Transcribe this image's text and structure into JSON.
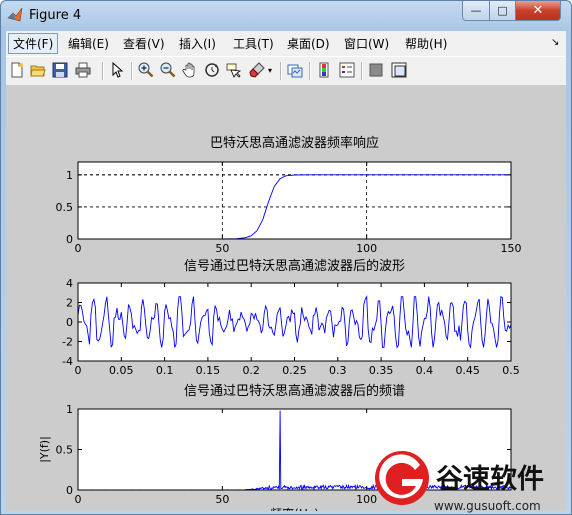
{
  "window": {
    "title": "Figure 4"
  },
  "menu": [
    "文件(F)",
    "编辑(E)",
    "查看(V)",
    "插入(I)",
    "工具(T)",
    "桌面(D)",
    "窗口(W)",
    "帮助(H)"
  ],
  "window_controls": {
    "minimize": "—",
    "maximize": "□",
    "close": "✕"
  },
  "toolbar": [
    "new-figure-icon",
    "open-file-icon",
    "save-icon",
    "print-icon",
    "select-arrow-icon",
    "zoom-in-icon",
    "zoom-out-icon",
    "pan-hand-icon",
    "rotate-3d-icon",
    "data-cursor-icon",
    "brush-icon",
    "link-plot-icon",
    "colorbar-icon",
    "legend-icon",
    "hide-plot-tools-icon",
    "show-plot-tools-icon"
  ],
  "watermark": {
    "brand": "谷速软件",
    "url": "www.gusuoft.com"
  },
  "chart_data": [
    {
      "type": "line",
      "title": "巴特沃思高通滤波器频率响应",
      "xlabel": "",
      "ylabel": "",
      "xlim": [
        0,
        150
      ],
      "ylim": [
        0,
        1.2
      ],
      "xticks": [
        "0",
        "50",
        "100",
        "150"
      ],
      "yticks": [
        "0",
        "0.5",
        "1"
      ],
      "grid": true,
      "series": [
        {
          "x": [
            0,
            40,
            50,
            55,
            58,
            60,
            62,
            64,
            66,
            68,
            70,
            72,
            75,
            80,
            90,
            100,
            150
          ],
          "y": [
            0,
            0,
            0.001,
            0.005,
            0.02,
            0.05,
            0.13,
            0.3,
            0.58,
            0.82,
            0.94,
            0.985,
            0.997,
            1,
            1,
            1,
            1
          ]
        }
      ]
    },
    {
      "type": "line",
      "title": "信号通过巴特沃思高通滤波器后的波形",
      "xlabel": "",
      "ylabel": "",
      "xlim": [
        0,
        0.5
      ],
      "ylim": [
        -4,
        4
      ],
      "xticks": [
        "0",
        "0.05",
        "0.1",
        "0.15",
        "0.2",
        "0.25",
        "0.3",
        "0.35",
        "0.4",
        "0.45",
        "0.5"
      ],
      "yticks": [
        "-4",
        "-2",
        "0",
        "2",
        "4"
      ],
      "grid": false,
      "series": [
        {
          "note_samples": 300,
          "amplitude": [
            -2.5,
            2.5
          ]
        }
      ]
    },
    {
      "type": "line",
      "title": "信号通过巴特沃思高通滤波器后的频谱",
      "xlabel": "频率(Hz)",
      "ylabel": "|Y(f)|",
      "xlim": [
        0,
        150
      ],
      "ylim": [
        0,
        1
      ],
      "xticks": [
        "0",
        "50",
        "100"
      ],
      "yticks": [
        "0",
        "0.5",
        "1"
      ],
      "grid": false,
      "series": [
        {
          "peak_x": 70,
          "peak_y": 0.98
        }
      ]
    }
  ]
}
